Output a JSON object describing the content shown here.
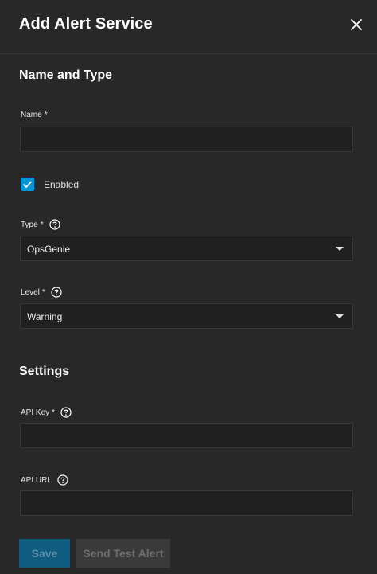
{
  "header": {
    "title": "Add Alert Service"
  },
  "sections": {
    "name_type": "Name and Type",
    "settings": "Settings"
  },
  "fields": {
    "name": {
      "label": "Name",
      "required": "*",
      "value": ""
    },
    "enabled": {
      "label": "Enabled",
      "checked": true
    },
    "type": {
      "label": "Type",
      "required": "*",
      "value": "OpsGenie"
    },
    "level": {
      "label": "Level",
      "required": "*",
      "value": "Warning"
    },
    "api_key": {
      "label": "API Key",
      "required": "*",
      "value": ""
    },
    "api_url": {
      "label": "API URL",
      "value": ""
    }
  },
  "buttons": {
    "save": "Save",
    "send_test": "Send Test Alert"
  },
  "colors": {
    "background": "#282828",
    "input_bg": "#202020",
    "accent": "#0095d5",
    "save_disabled": "#0f5c80",
    "test_disabled": "#3a3a3a"
  },
  "icons": {
    "close": "close-icon",
    "help": "help-circle-icon",
    "check": "checkmark-icon",
    "dropdown": "caret-down-icon"
  }
}
